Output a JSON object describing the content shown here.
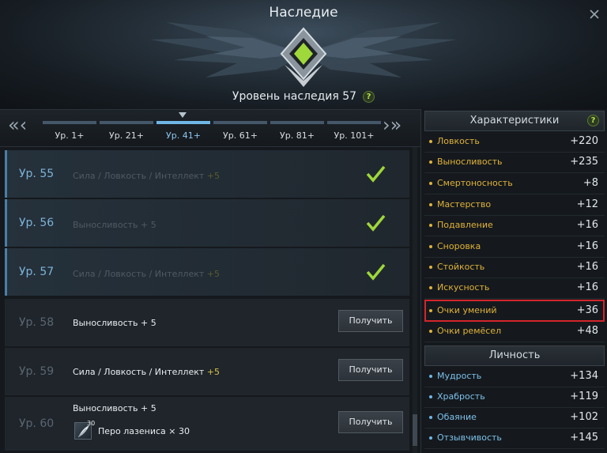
{
  "window": {
    "title": "Наследие",
    "close_icon": "close-icon"
  },
  "legacy": {
    "level_text": "Уровень наследия 57",
    "help": "?"
  },
  "tabs": {
    "prev_label": "«‹",
    "next_label": "›»",
    "items": [
      {
        "label": "Ур. 1+"
      },
      {
        "label": "Ур. 21+"
      },
      {
        "label": "Ур. 41+"
      },
      {
        "label": "Ур. 61+"
      },
      {
        "label": "Ур. 81+"
      },
      {
        "label": "Ур. 101+"
      }
    ],
    "active_index": 2
  },
  "rewards": [
    {
      "level": "Ур. 55",
      "text": "Сила / Ловкость / Интеллект",
      "bonus": "+5",
      "state": "claimed"
    },
    {
      "level": "Ур. 56",
      "text": "Выносливость + 5",
      "bonus": "",
      "state": "claimed"
    },
    {
      "level": "Ур. 57",
      "text": "Сила / Ловкость / Интеллект",
      "bonus": "+5",
      "state": "claimed"
    },
    {
      "level": "Ур. 58",
      "text": "Выносливость + 5",
      "bonus": "",
      "state": "available",
      "button": "Получить"
    },
    {
      "level": "Ур. 59",
      "text": "Сила / Ловкость / Интеллект",
      "bonus": "+5",
      "state": "available",
      "button": "Получить"
    },
    {
      "level": "Ур. 60",
      "text": "Выносливость + 5",
      "bonus": "",
      "state": "available",
      "button": "Получить",
      "item": {
        "count": "30",
        "name": "Перо лазениса × 30"
      }
    }
  ],
  "characteristics": {
    "title": "Характеристики",
    "help": "?",
    "stats": [
      {
        "name": "Ловкость",
        "value": "+220"
      },
      {
        "name": "Выносливость",
        "value": "+235"
      },
      {
        "name": "Смертоносность",
        "value": "+8"
      },
      {
        "name": "Мастерство",
        "value": "+12"
      },
      {
        "name": "Подавление",
        "value": "+16"
      },
      {
        "name": "Сноровка",
        "value": "+16"
      },
      {
        "name": "Стойкость",
        "value": "+16"
      },
      {
        "name": "Искусность",
        "value": "+16"
      },
      {
        "name": "Очки умений",
        "value": "+36"
      },
      {
        "name": "Очки ремёсел",
        "value": "+48"
      }
    ]
  },
  "personality": {
    "title": "Личность",
    "stats": [
      {
        "name": "Мудрость",
        "value": "+134"
      },
      {
        "name": "Храбрость",
        "value": "+119"
      },
      {
        "name": "Обаяние",
        "value": "+102"
      },
      {
        "name": "Отзывчивость",
        "value": "+145"
      }
    ]
  },
  "colors": {
    "accent_blue": "#6fb6e6",
    "stat_gold": "#e0b23a",
    "highlight_red": "#d4252b",
    "check_green": "#9ed83a"
  }
}
